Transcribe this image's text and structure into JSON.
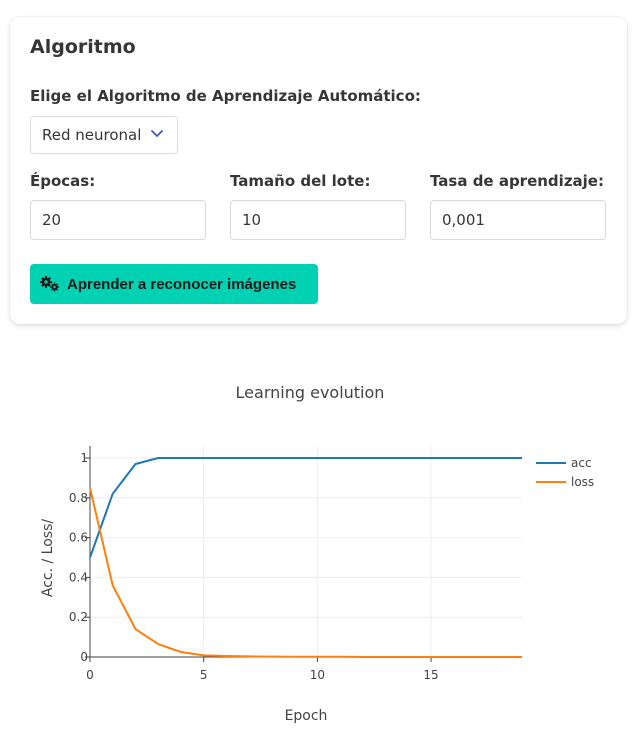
{
  "form": {
    "title": "Algoritmo",
    "algorithm_label": "Elige el Algoritmo de Aprendizaje Automático:",
    "algorithm_selected": "Red neuronal",
    "epochs_label": "Épocas:",
    "epochs_value": "20",
    "batch_label": "Tamaño del lote:",
    "batch_value": "10",
    "lr_label": "Tasa de aprendizaje:",
    "lr_value": "0,001",
    "train_button": "Aprender a reconocer imágenes"
  },
  "icons": {
    "select_chevron": "chevron-down-icon",
    "train_button": "cogs-icon"
  },
  "colors": {
    "accent": "#00d1b2",
    "chevron": "#3e56c4",
    "acc_line": "#1f77b4",
    "loss_line": "#ff7f0e"
  },
  "chart_data": {
    "type": "line",
    "title": "Learning evolution",
    "xlabel": "Epoch",
    "ylabel": "Acc. / Loss/",
    "xlim": [
      0,
      19
    ],
    "ylim": [
      0,
      1
    ],
    "x_ticks": [
      0,
      5,
      10,
      15
    ],
    "y_ticks": [
      0,
      0.2,
      0.4,
      0.6,
      0.8,
      1
    ],
    "y_tick_labels": [
      "0",
      "0.2",
      "0.4",
      "0.6",
      "0.8",
      "1"
    ],
    "grid": true,
    "legend": "top-right",
    "x": [
      0,
      1,
      2,
      3,
      4,
      5,
      6,
      7,
      8,
      9,
      10,
      11,
      12,
      13,
      14,
      15,
      16,
      17,
      18,
      19
    ],
    "series": [
      {
        "name": "acc",
        "values": [
          0.5,
          0.82,
          0.97,
          1,
          1,
          1,
          1,
          1,
          1,
          1,
          1,
          1,
          1,
          1,
          1,
          1,
          1,
          1,
          1,
          1
        ]
      },
      {
        "name": "loss",
        "values": [
          0.85,
          0.36,
          0.14,
          0.065,
          0.025,
          0.008,
          0.005,
          0.003,
          0.002,
          0.001,
          0.001,
          0.001,
          0,
          0,
          0,
          0,
          0,
          0,
          0,
          0
        ]
      }
    ]
  }
}
